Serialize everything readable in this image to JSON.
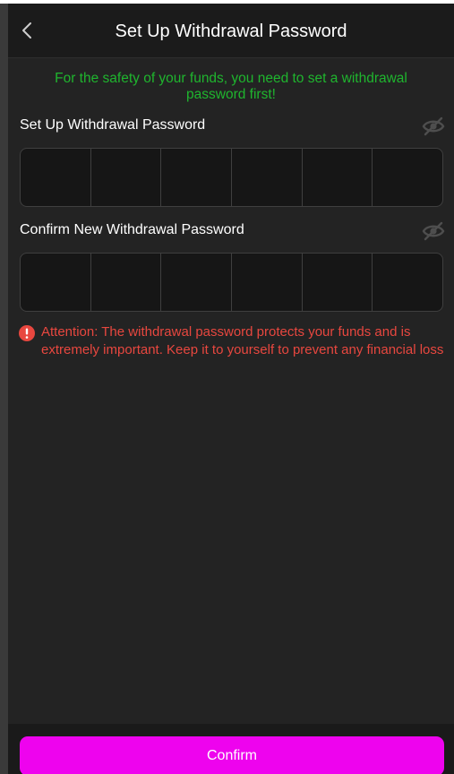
{
  "header": {
    "title": "Set Up Withdrawal Password",
    "back_icon": "chevron-left-icon"
  },
  "notice": "For the safety of your funds, you need to set a withdrawal password first!",
  "password_field": {
    "label": "Set Up Withdrawal Password",
    "visibility_icon": "eye-off-icon",
    "digits": 6
  },
  "confirm_field": {
    "label": "Confirm New Withdrawal Password",
    "visibility_icon": "eye-off-icon",
    "digits": 6
  },
  "warning": {
    "icon": "alert-circle-icon",
    "text": "Attention: The withdrawal password protects your funds and is extremely important. Keep it to yourself to prevent any financial loss"
  },
  "confirm_button": {
    "label": "Confirm"
  },
  "colors": {
    "background": "#232323",
    "header": "#1b1b1b",
    "notice": "#1fb52e",
    "warning": "#e8473f",
    "accent": "#ee03ee"
  }
}
